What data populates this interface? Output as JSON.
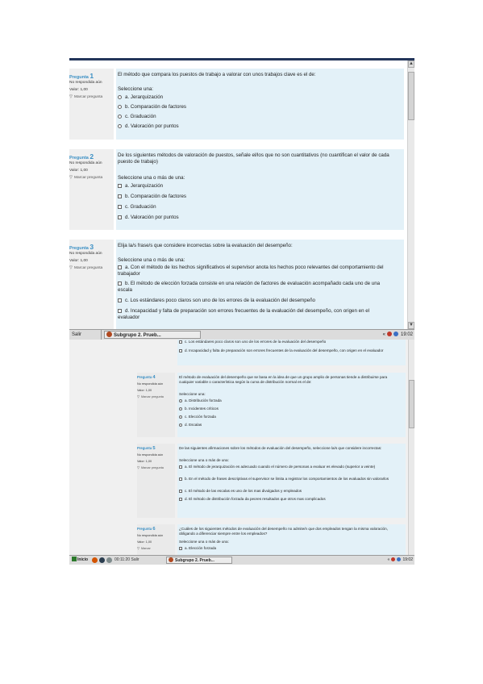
{
  "shot1": {
    "questions": [
      {
        "label": "Pregunta",
        "number": "1",
        "state": "No respondida aún",
        "grade": "Valor: 1,00",
        "flag": "Marcar pregunta",
        "text": "El método que compara los puestos de trabajo a valorar con unos trabajos clave es el de:",
        "prompt": "Seleccione una:",
        "options": [
          "a. Jerarquización",
          "b. Comparación de factores",
          "c. Graduación",
          "d. Valoración por puntos"
        ]
      },
      {
        "label": "Pregunta",
        "number": "2",
        "state": "No respondida aún",
        "grade": "Valor: 1,00",
        "flag": "Marcar pregunta",
        "text": "De los siguientes métodos de valoración de puestos, señale el/los que no son cuantitativos (no cuantifican el valor de cada puesto de trabajo)",
        "prompt": "Seleccione una o más de una:",
        "options": [
          "a. Jerarquización",
          "b. Comparación de factores",
          "c. Graduación",
          "d. Valoración por puntos"
        ]
      },
      {
        "label": "Pregunta",
        "number": "3",
        "state": "No respondida aún",
        "grade": "Valor: 1,00",
        "flag": "Marcar pregunta",
        "text": "Elija la/s frase/s que considere incorrectas sobre la evaluación del desempeño:",
        "prompt": "Seleccione una o más de una:",
        "options": [
          "a. Con el método de los hechos significativos el supervisor anota los hechos poco relevantes del comportamiento del trabajador",
          "b. El método de elección forzada consiste en una relación de factores de evaluación acompañado cada uno de una escala",
          "c. Los estándares poco claros son uno de los errores de la evaluación del desempeño",
          "d. Incapacidad y falta de preparación son errores frecuentes de la evaluación del desempeño, con origen en el evaluador"
        ]
      }
    ],
    "taskbar": {
      "exit": "Salir",
      "app": "Subgrupo 2. Prueb...",
      "arrows": "«",
      "clock": "19:02"
    }
  },
  "shot2": {
    "top_options": [
      "c. Los estándares poco claros son uno de los errores de la evaluación del desempeño",
      "d. Incapacidad y falta de preparación son errores frecuentes de la evaluación del desempeño, con origen en el evaluador"
    ],
    "questions": [
      {
        "label": "Pregunta",
        "number": "4",
        "state": "No respondida aún",
        "grade": "Valor: 1,00",
        "flag": "Marcar pregunta",
        "text": "El método de evaluación del desempeño que se basa en la idea de que un grupo amplio de personas tiende a distribuirse para cualquier variable o característica según la curva de distribución normal es el de:",
        "prompt": "Seleccione una:",
        "options": [
          "a. Distribución forzada",
          "b. Incidentes críticos",
          "c. Elección forzada",
          "d. Escalas"
        ]
      },
      {
        "label": "Pregunta",
        "number": "5",
        "state": "No respondida aún",
        "grade": "Valor: 1,00",
        "flag": "Marcar pregunta",
        "text": "De las siguientes afirmaciones sobre los métodos de evaluación del desempeño, seleccione la/s que considere incorrectas:",
        "prompt": "Seleccione una o más de una:",
        "options": [
          "a. El método de jerarquización es adecuado cuando el número de personas a evaluar es elevado (superior a veinte)",
          "b. En el método de frases descriptivas el supervisor se limita a registrar los comportamientos de los evaluados sin valorarlos",
          "c. El método de las escalas es uno de los mas divulgados y empleados",
          "d. El método de distribución forzada da peores resultados que otros mas complicados"
        ]
      },
      {
        "label": "Pregunta",
        "number": "6",
        "state": "No respondida aún",
        "grade": "Valor: 1,00",
        "flag": "Marcar",
        "text": "¿Cuáles de los siguientes métodos de evaluación del desempeño no admite/n que dos empleados tengan la misma valoración, obligando a diferenciar siempre entre los empleados?",
        "prompt": "Seleccione una o más de una:",
        "options": [
          "a. Elección forzada"
        ]
      }
    ],
    "taskbar": {
      "start": "Inicio",
      "timer": "00:11:20 Salir",
      "app": "Subgrupo 2. Prueb...",
      "arrows": "«",
      "clock": "19:02"
    }
  },
  "colors": {
    "accent": "#3a8fc4",
    "content_bg": "#e3f1f8",
    "info_bg": "#efefef",
    "header_bar": "#23355a"
  }
}
